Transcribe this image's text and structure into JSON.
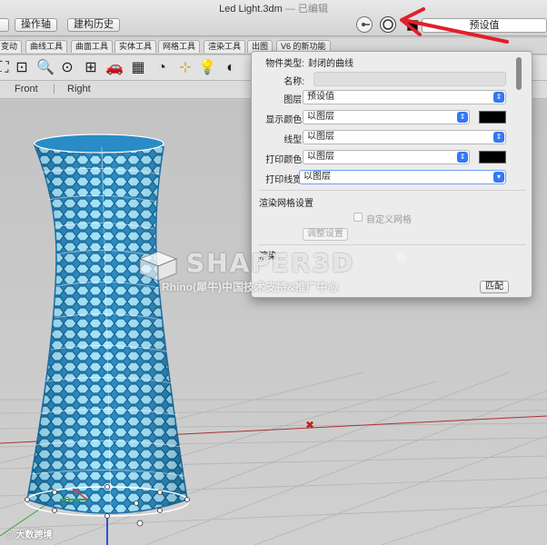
{
  "window": {
    "title": "Led Light.3dm",
    "title_suffix": "— 已编辑"
  },
  "toolbar": {
    "operate_axis_label": "操作轴",
    "history_label": "建构历史",
    "layer_select_value": "预设值",
    "layer_color": "#000000"
  },
  "tool_tabs": [
    "变动",
    "曲线工具",
    "曲面工具",
    "实体工具",
    "网格工具",
    "渲染工具",
    "出图",
    "V6 的新功能"
  ],
  "icons": [
    "zoom-extents-icon",
    "zoom-window-icon",
    "zoom-selected-icon",
    "zoom-target-icon",
    "four-viewports-icon",
    "car-icon",
    "grid-icon",
    "snapshot-icon",
    "snap-icon",
    "bulb-icon",
    "render-icon"
  ],
  "view_tabs": [
    "Front",
    "Right"
  ],
  "properties": {
    "object_type_label": "物件类型:",
    "object_type_value": "封闭的曲线",
    "name_label": "名称:",
    "name_value": "",
    "layer_label": "图层:",
    "layer_value": "预设值",
    "display_color_label": "显示颜色:",
    "display_color_value": "以图层",
    "display_color_swatch": "#000000",
    "linetype_label": "线型:",
    "linetype_value": "以图层",
    "print_color_label": "打印颜色:",
    "print_color_value": "以图层",
    "print_color_swatch": "#000000",
    "print_width_label": "打印线宽:",
    "print_width_value": "以图层",
    "render_mesh_section": "渲染网格设置",
    "custom_mesh_label": "自定义网格",
    "custom_mesh_checked": false,
    "adjust_button": "调整设置",
    "render_section": "渲染",
    "match_button": "匹配"
  },
  "watermark": {
    "brand": "SHAPER3D",
    "registered": "®",
    "subtitle": "Rhino(犀牛)中国技术支持&推广中心",
    "corner": "大数跨境"
  },
  "colors": {
    "accent": "#3478f6",
    "arrow_red": "#e0202a",
    "model_blue": "#2aa7d8"
  }
}
